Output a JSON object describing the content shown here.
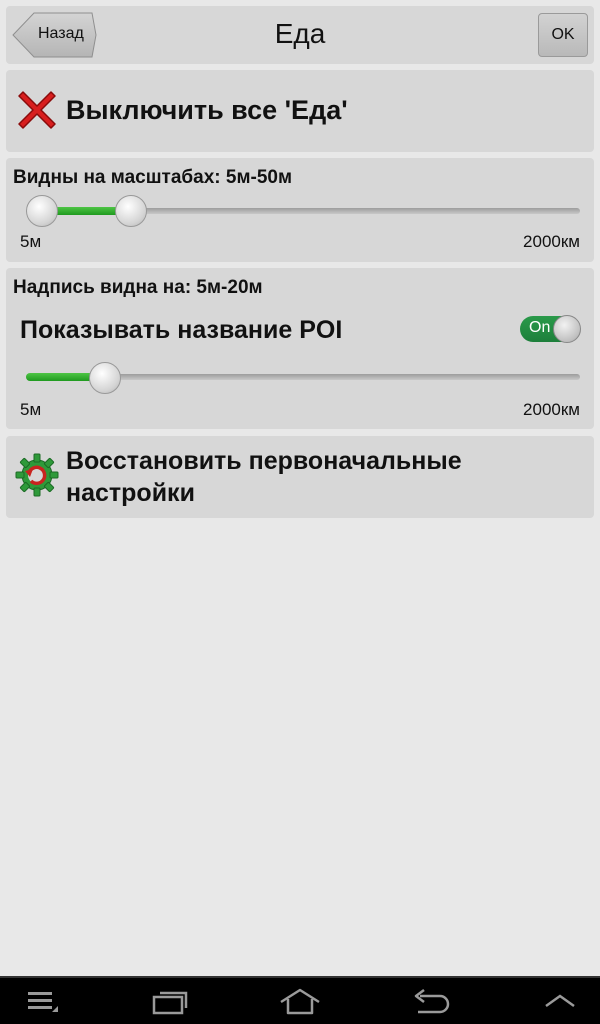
{
  "header": {
    "back_label": "Назад",
    "title": "Еда",
    "ok_label": "OK"
  },
  "disable_all": {
    "label": "Выключить все 'Еда'",
    "icon": "red-x-icon"
  },
  "visible_scales": {
    "title": "Видны на масштабах: 5м-50м",
    "min_label": "5м",
    "max_label": "2000км",
    "range_low": 0.0,
    "range_high": 0.17
  },
  "label_visible": {
    "title": "Надпись видна на: 5м-20м",
    "show_poi_label": "Показывать название POI",
    "toggle_label": "On",
    "toggle_state": true,
    "min_label": "5м",
    "max_label": "2000км",
    "value": 0.12
  },
  "reset": {
    "label_line1": "Восстановить первоначальные",
    "label_line2": "настройки",
    "icon": "gear-reset-icon"
  },
  "navbar": {
    "icons": [
      "menu-icon",
      "recent-apps-icon",
      "home-icon",
      "back-icon",
      "expand-up-icon"
    ]
  },
  "colors": {
    "accent_green": "#2bab2b",
    "toggle_green": "#1d7f3b",
    "card_bg": "#d7d7d7",
    "screen_bg": "#e8e8e8"
  }
}
